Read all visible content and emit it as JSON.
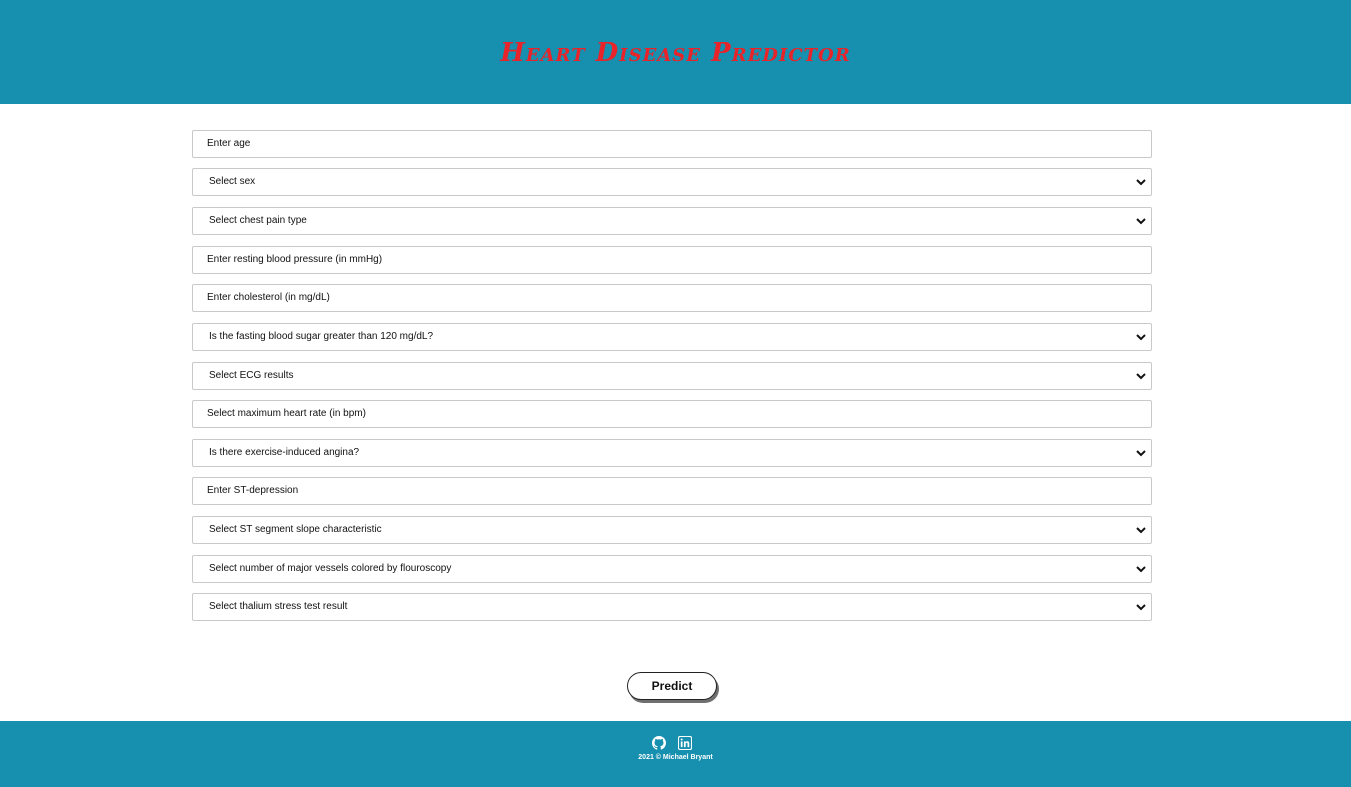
{
  "header": {
    "title": "Heart Disease Predictor"
  },
  "form": {
    "fields": [
      {
        "kind": "input",
        "placeholder": "Enter age"
      },
      {
        "kind": "select",
        "label": "Select sex"
      },
      {
        "kind": "select",
        "label": "Select chest pain type"
      },
      {
        "kind": "input",
        "placeholder": "Enter resting blood pressure (in mmHg)"
      },
      {
        "kind": "input",
        "placeholder": "Enter cholesterol (in mg/dL)"
      },
      {
        "kind": "select",
        "label": "Is the fasting blood sugar greater than 120 mg/dL?"
      },
      {
        "kind": "select",
        "label": "Select ECG results"
      },
      {
        "kind": "input",
        "placeholder": "Select maximum heart rate (in bpm)"
      },
      {
        "kind": "select",
        "label": "Is there exercise-induced angina?"
      },
      {
        "kind": "input",
        "placeholder": "Enter ST-depression"
      },
      {
        "kind": "select",
        "label": "Select ST segment slope characteristic"
      },
      {
        "kind": "select",
        "label": "Select number of major vessels colored by flouroscopy"
      },
      {
        "kind": "select",
        "label": "Select thalium stress test result"
      }
    ],
    "submit_label": "Predict"
  },
  "footer": {
    "icons": [
      "github-icon",
      "linkedin-icon"
    ],
    "copyright": "2021 © Michael Bryant"
  },
  "colors": {
    "header_bg": "#178fae",
    "title": "#e8232a",
    "footer_bg": "#178fae"
  }
}
